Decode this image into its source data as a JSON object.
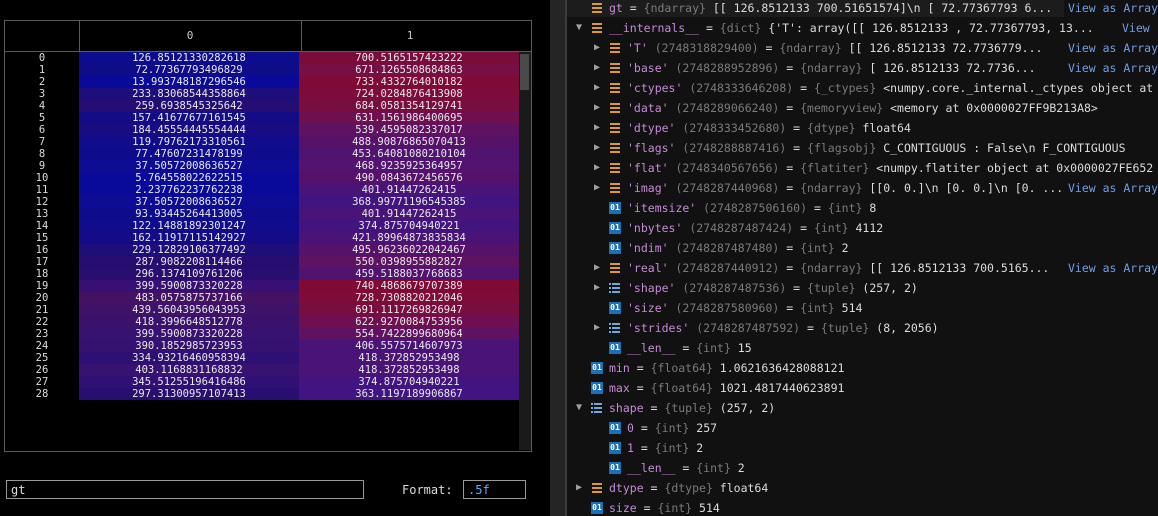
{
  "grid": {
    "col_headers": [
      "0",
      "1"
    ],
    "rows": [
      {
        "i": "0",
        "a": "126.85121330282618",
        "b": "700.5165157423222",
        "ca": "#0c0c8e",
        "cb": "#7a0c3c"
      },
      {
        "i": "1",
        "a": "72.77367793496829",
        "b": "671.1265508684863",
        "ca": "#0f0c8a",
        "cb": "#760f44"
      },
      {
        "i": "2",
        "a": "13.993748187296546",
        "b": "733.4332764010182",
        "ca": "#0a0a9a",
        "cb": "#7f0a36"
      },
      {
        "i": "3",
        "a": "233.83068544358864",
        "b": "724.0284876413908",
        "ca": "#1e0e7a",
        "cb": "#7d0c3a"
      },
      {
        "i": "4",
        "a": "259.6938545325642",
        "b": "684.0581354129741",
        "ca": "#240e74",
        "cb": "#780e40"
      },
      {
        "i": "5",
        "a": "157.41677677161545",
        "b": "631.1561986400695",
        "ca": "#140c86",
        "cb": "#6e1050"
      },
      {
        "i": "6",
        "a": "184.45554445554444",
        "b": "539.4595082337017",
        "ca": "#180c80",
        "cb": "#5e1260"
      },
      {
        "i": "7",
        "a": "119.79762173310561",
        "b": "488.90876865070413",
        "ca": "#100c8c",
        "cb": "#561268"
      },
      {
        "i": "8",
        "a": "77.47607231478199",
        "b": "453.64081080210104",
        "ca": "#0e0c8c",
        "cb": "#501470"
      },
      {
        "i": "9",
        "a": "37.50572008636527",
        "b": "468.9235925364957",
        "ca": "#0c0c94",
        "cb": "#521470"
      },
      {
        "i": "10",
        "a": "5.764558022622515",
        "b": "490.0843672456576",
        "ca": "#0a0a9a",
        "cb": "#56126a"
      },
      {
        "i": "11",
        "a": "2.237762237762238",
        "b": "401.91447262415",
        "ca": "#0a0a9a",
        "cb": "#481478"
      },
      {
        "i": "12",
        "a": "37.50572008636527",
        "b": "368.99771196545385",
        "ca": "#0c0c94",
        "cb": "#421480"
      },
      {
        "i": "13",
        "a": "93.93445264413005",
        "b": "401.91447262415",
        "ca": "#0e0c8c",
        "cb": "#481478"
      },
      {
        "i": "14",
        "a": "122.14881892301247",
        "b": "374.875704940221",
        "ca": "#100c8c",
        "cb": "#421480"
      },
      {
        "i": "15",
        "a": "162.11917115142927",
        "b": "421.89964873835834",
        "ca": "#140c86",
        "cb": "#4a1476"
      },
      {
        "i": "16",
        "a": "229.12829106377492",
        "b": "495.96236022042467",
        "ca": "#1e0e7a",
        "cb": "#56126a"
      },
      {
        "i": "17",
        "a": "287.9082208114466",
        "b": "550.0398955882827",
        "ca": "#260e70",
        "cb": "#5e1262"
      },
      {
        "i": "18",
        "a": "296.1374109761206",
        "b": "459.5188037768683",
        "ca": "#280e6e",
        "cb": "#501470"
      },
      {
        "i": "19",
        "a": "399.5900873320228",
        "b": "740.4868679707389",
        "ca": "#381074",
        "cb": "#800a34"
      },
      {
        "i": "20",
        "a": "483.0575875737166",
        "b": "728.7308820212046",
        "ca": "#441262",
        "cb": "#7e0c38"
      },
      {
        "i": "21",
        "a": "439.56043956043953",
        "b": "691.1117269826947",
        "ca": "#3e1268",
        "cb": "#780e40"
      },
      {
        "i": "22",
        "a": "418.3996648512778",
        "b": "622.9270084753956",
        "ca": "#3a126c",
        "cb": "#6e1050"
      },
      {
        "i": "23",
        "a": "399.5900873320228",
        "b": "554.7422899680964",
        "ca": "#381270",
        "cb": "#601262"
      },
      {
        "i": "24",
        "a": "390.1852985723953",
        "b": "406.5575714607973",
        "ca": "#361270",
        "cb": "#481478"
      },
      {
        "i": "25",
        "a": "334.93216460958394",
        "b": "418.372852953498",
        "ca": "#2e1074",
        "cb": "#4a1476"
      },
      {
        "i": "26",
        "a": "403.1168831168832",
        "b": "418.372852953498",
        "ca": "#381270",
        "cb": "#4a1476"
      },
      {
        "i": "27",
        "a": "345.51255196416486",
        "b": "374.875704940221",
        "ca": "#301074",
        "cb": "#421480"
      },
      {
        "i": "28",
        "a": "297.31300957107413",
        "b": "363.1197189906867",
        "ca": "#280e6e",
        "cb": "#401482"
      }
    ]
  },
  "name_field": "gt",
  "format": {
    "label": "Format:",
    "value": ".5f"
  },
  "tree": {
    "view_as_array": "View as Array",
    "view": "View",
    "lines": [
      {
        "indent": 0,
        "arrow": "",
        "icon": "list",
        "name": "gt",
        "eq": " = ",
        "type": "{ndarray}",
        "val": " [[ 126.8512133    700.51651574]\\n [  72.77367793   6...",
        "link": "View as Array",
        "hl": true
      },
      {
        "indent": 0,
        "arrow": "▼",
        "icon": "list",
        "name": "__internals__",
        "eq": " = ",
        "type": "{dict}",
        "val": " {'T': array([[ 126.8512133 ,   72.77367793,   13...",
        "link": "View"
      },
      {
        "indent": 1,
        "arrow": "▶",
        "icon": "list",
        "name": "'T'",
        "id": " (2748318829400)",
        "eq": " = ",
        "type": "{ndarray}",
        "val": " [[ 126.8512133    72.7736779...",
        "link": "View as Array"
      },
      {
        "indent": 1,
        "arrow": "▶",
        "icon": "list",
        "name": "'base'",
        "id": " (2748288952896)",
        "eq": " = ",
        "type": "{ndarray}",
        "val": " [ 126.8512133    72.7736...",
        "link": "View as Array"
      },
      {
        "indent": 1,
        "arrow": "▶",
        "icon": "list",
        "name": "'ctypes'",
        "id": " (2748333646208)",
        "eq": " = ",
        "type": "{_ctypes}",
        "val": " <numpy.core._internal._ctypes object at 0x"
      },
      {
        "indent": 1,
        "arrow": "▶",
        "icon": "list",
        "name": "'data'",
        "id": " (2748289066240)",
        "eq": " = ",
        "type": "{memoryview}",
        "val": " <memory at 0x0000027FF9B213A8>"
      },
      {
        "indent": 1,
        "arrow": "▶",
        "icon": "list",
        "name": "'dtype'",
        "id": " (2748333452680)",
        "eq": " = ",
        "type": "{dtype}",
        "val": " float64"
      },
      {
        "indent": 1,
        "arrow": "▶",
        "icon": "list",
        "name": "'flags'",
        "id": " (2748288887416)",
        "eq": " = ",
        "type": "{flagsobj}",
        "val": "   C_CONTIGUOUS : False\\n  F_CONTIGUOUS"
      },
      {
        "indent": 1,
        "arrow": "▶",
        "icon": "list",
        "name": "'flat'",
        "id": " (2748340567656)",
        "eq": " = ",
        "type": "{flatiter}",
        "val": " <numpy.flatiter object at 0x0000027FE652"
      },
      {
        "indent": 1,
        "arrow": "▶",
        "icon": "list",
        "name": "'imag'",
        "id": " (2748287440968)",
        "eq": " = ",
        "type": "{ndarray}",
        "val": " [[0. 0.]\\n [0. 0.]\\n [0. ...",
        "link": "View as Array"
      },
      {
        "indent": 1,
        "arrow": "",
        "icon": "num",
        "name": "'itemsize'",
        "id": " (2748287506160)",
        "eq": " = ",
        "type": "{int}",
        "val": " 8"
      },
      {
        "indent": 1,
        "arrow": "",
        "icon": "num",
        "name": "'nbytes'",
        "id": " (2748287487424)",
        "eq": " = ",
        "type": "{int}",
        "val": " 4112"
      },
      {
        "indent": 1,
        "arrow": "",
        "icon": "num",
        "name": "'ndim'",
        "id": " (2748287487480)",
        "eq": " = ",
        "type": "{int}",
        "val": " 2"
      },
      {
        "indent": 1,
        "arrow": "▶",
        "icon": "list",
        "name": "'real'",
        "id": " (2748287440912)",
        "eq": " = ",
        "type": "{ndarray}",
        "val": " [[ 126.8512133   700.5165...",
        "link": "View as Array"
      },
      {
        "indent": 1,
        "arrow": "▶",
        "icon": "tup",
        "name": "'shape'",
        "id": " (2748287487536)",
        "eq": " = ",
        "type": "{tuple}",
        "val": " (257, 2)"
      },
      {
        "indent": 1,
        "arrow": "",
        "icon": "num",
        "name": "'size'",
        "id": " (2748287580960)",
        "eq": " = ",
        "type": "{int}",
        "val": " 514"
      },
      {
        "indent": 1,
        "arrow": "▶",
        "icon": "tup",
        "name": "'strides'",
        "id": " (2748287487592)",
        "eq": " = ",
        "type": "{tuple}",
        "val": " (8, 2056)"
      },
      {
        "indent": 1,
        "arrow": "",
        "icon": "num",
        "name": "__len__",
        "eq": " = ",
        "type": "{int}",
        "val": " 15",
        "plain": true
      },
      {
        "indent": 0,
        "arrow": "",
        "icon": "num",
        "name": "min",
        "eq": " = ",
        "type": "{float64}",
        "val": " 1.0621636428088121",
        "plain": true
      },
      {
        "indent": 0,
        "arrow": "",
        "icon": "num",
        "name": "max",
        "eq": " = ",
        "type": "{float64}",
        "val": " 1021.4817440623891",
        "plain": true
      },
      {
        "indent": 0,
        "arrow": "▼",
        "icon": "tup",
        "name": "shape",
        "eq": " = ",
        "type": "{tuple}",
        "val": " (257, 2)",
        "plain": true
      },
      {
        "indent": 1,
        "arrow": "",
        "icon": "num",
        "name": "0",
        "eq": " = ",
        "type": "{int}",
        "val": " 257",
        "plain": true
      },
      {
        "indent": 1,
        "arrow": "",
        "icon": "num",
        "name": "1",
        "eq": " = ",
        "type": "{int}",
        "val": " 2",
        "plain": true
      },
      {
        "indent": 1,
        "arrow": "",
        "icon": "num",
        "name": "__len__",
        "eq": " = ",
        "type": "{int}",
        "val": " 2",
        "plain": true
      },
      {
        "indent": 0,
        "arrow": "▶",
        "icon": "list",
        "name": "dtype",
        "eq": " = ",
        "type": "{dtype}",
        "val": " float64",
        "plain": true
      },
      {
        "indent": 0,
        "arrow": "",
        "icon": "num",
        "name": "size",
        "eq": " = ",
        "type": "{int}",
        "val": " 514",
        "plain": true
      }
    ]
  },
  "colors": {
    "key": "#c78ad8",
    "type": "#7a7a7a",
    "link": "#6f9fe6",
    "orange": "#e09a2a",
    "blue": "#1d6fb8"
  }
}
